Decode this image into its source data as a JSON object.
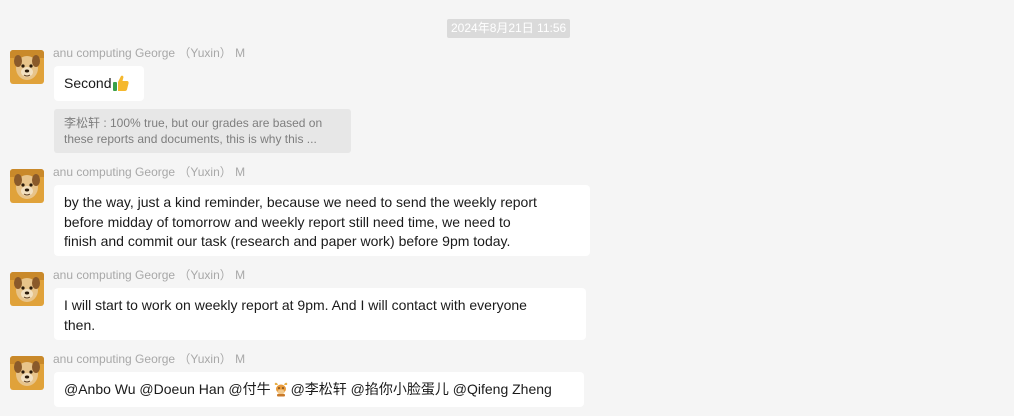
{
  "chat": {
    "timestamp": "2024年8月21日 11:56",
    "sender_name": "anu computing George （Yuxin） M",
    "messages": [
      {
        "text": "Second",
        "emoji": "thumbs-up-icon",
        "quote": {
          "line1": "李松轩 : 100% true, but our grades are based on",
          "line2": "these reports and documents, this is why this ..."
        }
      },
      {
        "lines": [
          "by the way, just a kind reminder,  because we need to send the weekly report",
          "before midday of tomorrow and weekly report still need time, we need to",
          "finish and commit our task (research and paper work) before 9pm today."
        ]
      },
      {
        "lines": [
          "I will start to work on weekly report at 9pm. And I will contact with everyone",
          "then."
        ]
      },
      {
        "mentions_before": "@Anbo Wu @Doeun Han @付牛",
        "emoji": "ox-icon",
        "mentions_after": "@李松轩 @掐你小脸蛋儿 @Qifeng Zheng"
      }
    ]
  },
  "colors": {
    "background": "#f5f5f5",
    "bubble": "#ffffff",
    "quote_bg": "#e7e7e7",
    "sender_text": "#a8a8a8",
    "timestamp_bg": "#dadada"
  }
}
